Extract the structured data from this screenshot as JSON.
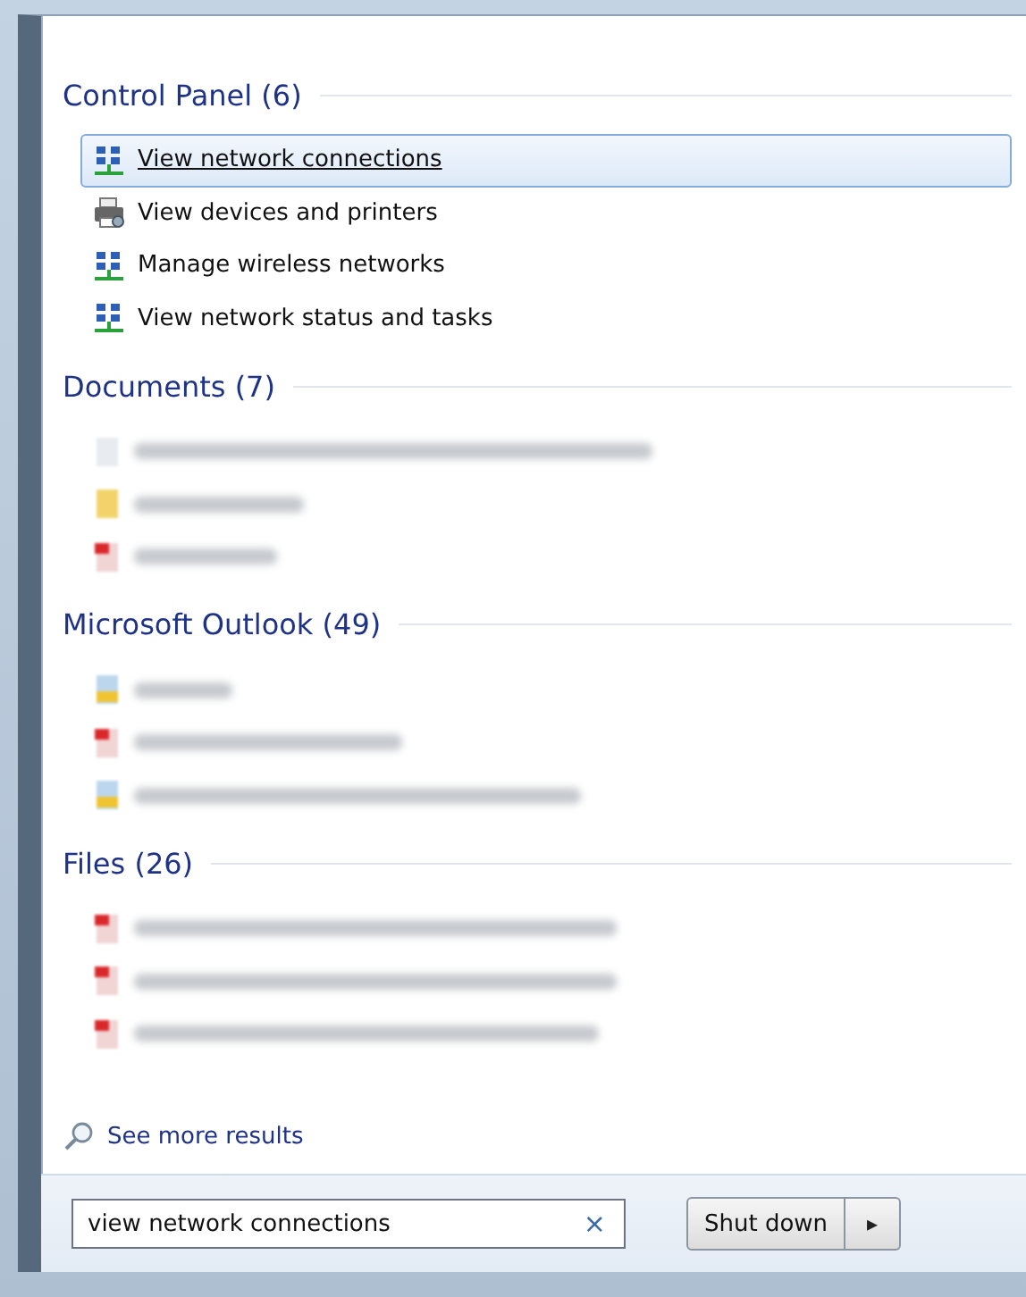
{
  "sections": [
    {
      "title": "Control Panel (6)",
      "items": [
        {
          "kind": "network",
          "label": "View network connections",
          "selected": true
        },
        {
          "kind": "printer",
          "label": "View devices and printers",
          "selected": false
        },
        {
          "kind": "network",
          "label": "Manage wireless networks",
          "selected": false
        },
        {
          "kind": "network",
          "label": "View network status and tasks",
          "selected": false
        }
      ]
    },
    {
      "title": "Documents (7)",
      "items": [
        {
          "kind": "file",
          "selected": false
        },
        {
          "kind": "zip",
          "selected": false
        },
        {
          "kind": "pdf",
          "selected": false
        }
      ]
    },
    {
      "title": "Microsoft Outlook (49)",
      "items": [
        {
          "kind": "mail",
          "selected": false
        },
        {
          "kind": "pdf",
          "selected": false
        },
        {
          "kind": "mail",
          "selected": false
        }
      ]
    },
    {
      "title": "Files (26)",
      "items": [
        {
          "kind": "pdf",
          "selected": false
        },
        {
          "kind": "pdf",
          "selected": false
        },
        {
          "kind": "pdf",
          "selected": false
        }
      ]
    }
  ],
  "see_more": "See more results",
  "search": {
    "value": "view network connections",
    "clear": "×"
  },
  "shutdown": {
    "label": "Shut down",
    "arrow": "▸"
  }
}
